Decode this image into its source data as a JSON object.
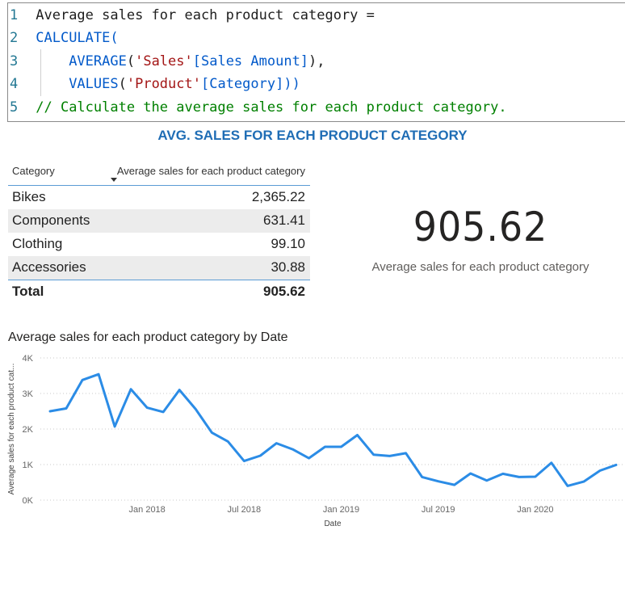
{
  "code": {
    "line_numbers": [
      "1",
      "2",
      "3",
      "4",
      "5"
    ],
    "line1": "Average sales for each product category =",
    "calc_keyword": "CALCULATE",
    "calc_open": "(",
    "average_fn": "AVERAGE",
    "average_open": "(",
    "average_arg_table": "'Sales'",
    "average_arg_col": "[Sales Amount]",
    "average_close": "),",
    "values_fn": "VALUES",
    "values_open": "(",
    "values_arg_table": "'Product'",
    "values_arg_col": "[Category]",
    "values_close": "))",
    "comment": "// Calculate the average sales for each product category."
  },
  "report_title": "AVG. SALES FOR EACH PRODUCT CATEGORY",
  "table": {
    "headers": {
      "category": "Category",
      "measure": "Average sales for each product category"
    },
    "rows": [
      {
        "category": "Bikes",
        "value": "2,365.22"
      },
      {
        "category": "Components",
        "value": "631.41"
      },
      {
        "category": "Clothing",
        "value": "99.10"
      },
      {
        "category": "Accessories",
        "value": "30.88"
      }
    ],
    "total": {
      "label": "Total",
      "value": "905.62"
    }
  },
  "card": {
    "value": "905.62",
    "label": "Average sales for each product category"
  },
  "line_chart_title": "Average sales for each product category by Date",
  "colors": {
    "line": "#2b8ce6",
    "title_blue": "#1f6db5",
    "table_rule": "#5b9bd5"
  },
  "chart_data": {
    "type": "line",
    "title": "Average sales for each product category by Date",
    "xlabel": "Date",
    "ylabel": "Average sales for each product cat...",
    "ylim": [
      0,
      4000
    ],
    "y_ticks": [
      "0K",
      "1K",
      "2K",
      "3K",
      "4K"
    ],
    "x_ticks": [
      "Jan 2018",
      "Jul 2018",
      "Jan 2019",
      "Jul 2019",
      "Jan 2020"
    ],
    "grid": true,
    "x": [
      "2017-07",
      "2017-08",
      "2017-09",
      "2017-10",
      "2017-11",
      "2017-12",
      "2018-01",
      "2018-02",
      "2018-03",
      "2018-04",
      "2018-05",
      "2018-06",
      "2018-07",
      "2018-08",
      "2018-09",
      "2018-10",
      "2018-11",
      "2018-12",
      "2019-01",
      "2019-02",
      "2019-03",
      "2019-04",
      "2019-05",
      "2019-06",
      "2019-07",
      "2019-08",
      "2019-09",
      "2019-10",
      "2019-11",
      "2019-12",
      "2020-01",
      "2020-02",
      "2020-03",
      "2020-04",
      "2020-05",
      "2020-06"
    ],
    "series": [
      {
        "values": [
          2500,
          2580,
          3380,
          3540,
          2070,
          3120,
          2600,
          2480,
          3100,
          2560,
          1900,
          1650,
          1100,
          1250,
          1600,
          1430,
          1180,
          1500,
          1500,
          1830,
          1280,
          1240,
          1320,
          650,
          530,
          430,
          750,
          550,
          740,
          650,
          660,
          1050,
          400,
          520,
          830,
          990
        ]
      }
    ]
  }
}
